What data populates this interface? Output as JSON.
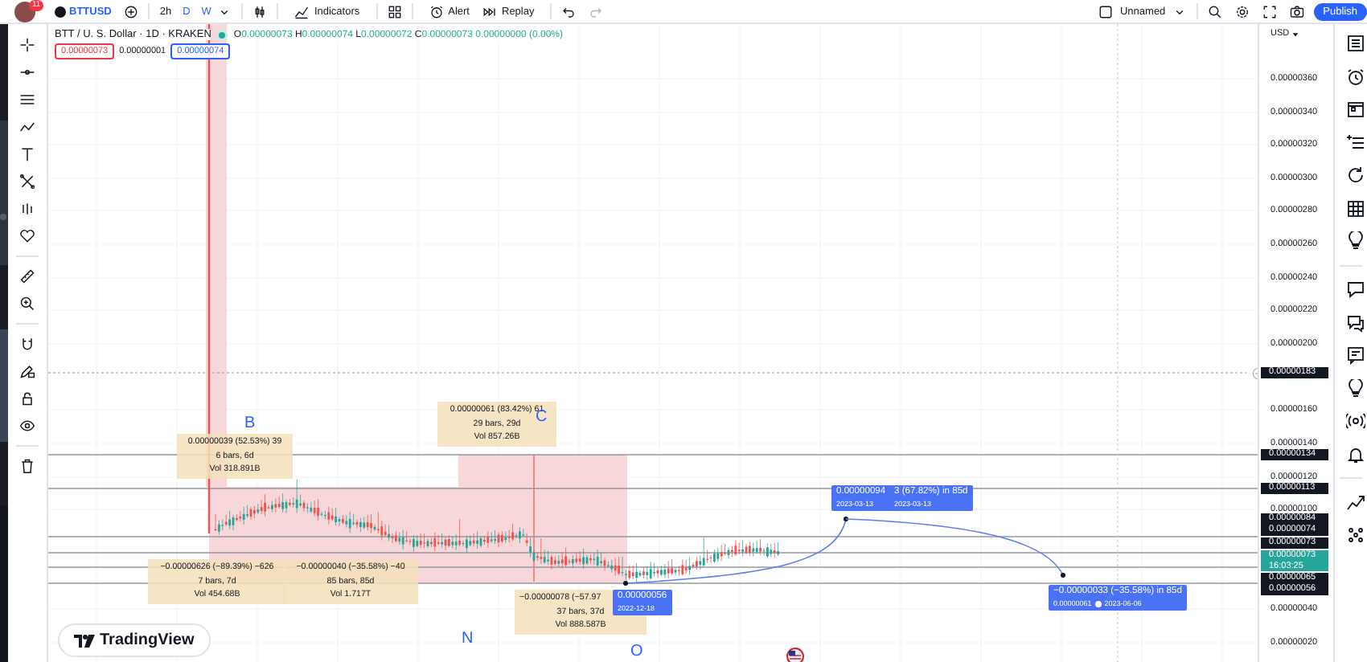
{
  "top_bar": {
    "avatar_badge": "11",
    "symbol": "BTTUSD",
    "intervals": [
      {
        "label": "2h",
        "highlighted": false
      },
      {
        "label": "D",
        "highlighted": true
      },
      {
        "label": "W",
        "highlighted": true
      }
    ],
    "tools": [
      {
        "kind": "indicators",
        "label": "Indicators"
      },
      {
        "kind": "alert",
        "label": "Alert"
      },
      {
        "kind": "replay",
        "label": "Replay"
      }
    ],
    "layout_name": "Unnamed",
    "publish": "Publish"
  },
  "legend": {
    "title": "BTT / U. S. Dollar · 1D · KRAKEN",
    "ohlc": [
      {
        "key": "O",
        "value": "0.00000073"
      },
      {
        "key": "H",
        "value": "0.00000074"
      },
      {
        "key": "L",
        "value": "0.00000072"
      },
      {
        "key": "C",
        "value": "0.00000073"
      }
    ],
    "change": "0.00000000 (0.00%)",
    "sell_price": "0.00000073",
    "spread": "0.00000001",
    "buy_price": "0.00000074"
  },
  "chart": {
    "wave_labels": [
      "B",
      "C",
      "N",
      "O"
    ],
    "measures": [
      {
        "lines": [
          "0.00000039 (52.53%) 39",
          "6 bars, 6d",
          "Vol 318.891B"
        ]
      },
      {
        "lines": [
          "0.00000061 (83.42%) 61",
          "29 bars, 29d",
          "Vol 857.26B"
        ]
      },
      {
        "lines": [
          "−0.00000626 (−89.39%) −626",
          "7 bars, 7d",
          "Vol 454.68B"
        ]
      },
      {
        "lines": [
          "−0.00000040 (−35.58%) −40",
          "85 bars, 85d",
          "Vol 1.717T"
        ]
      },
      {
        "lines": [
          "−0.00000078 (−57.97",
          "37 bars, 37d",
          "Vol 888.587B"
        ]
      }
    ],
    "price_labels": [
      {
        "main": "0.00000056",
        "sub": "2022-12-18"
      },
      {
        "main": "0.00000094",
        "sub": "2023-03-13"
      },
      {
        "main": "3 (67.82%) in 85d",
        "sub": "2023-03-13"
      },
      {
        "main": "−0.00000033 (−35.58%) in 85d",
        "sub": "0.00000061",
        "date": "2023-06-06"
      }
    ]
  },
  "price_axis": {
    "currency": "USD",
    "ticks": [
      "0.00000360",
      "0.00000340",
      "0.00000320",
      "0.00000300",
      "0.00000280",
      "0.00000260",
      "0.00000240",
      "0.00000220",
      "0.00000200",
      "0.00000160",
      "0.00000140",
      "0.00000120",
      "0.00000100",
      "0.00000040",
      "0.00000020"
    ],
    "badges": [
      {
        "kind": "level",
        "text": "0.00000183"
      },
      {
        "kind": "level",
        "text": "0.00000134"
      },
      {
        "kind": "level",
        "text": "0.00000113"
      },
      {
        "kind": "level",
        "text": "0.00000084"
      },
      {
        "kind": "level",
        "text": "0.00000074"
      },
      {
        "kind": "level",
        "text": "0.00000073"
      },
      {
        "kind": "last",
        "text": "0.00000073",
        "time": "16:03:25"
      },
      {
        "kind": "level",
        "text": "0.00000065"
      },
      {
        "kind": "level",
        "text": "0.00000056"
      }
    ]
  },
  "logo": "TradingView"
}
